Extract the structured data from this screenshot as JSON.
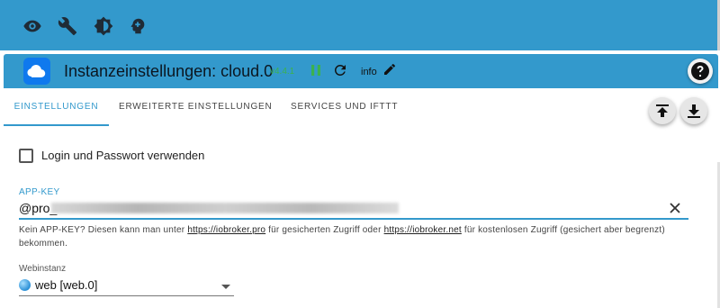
{
  "topbar": {
    "icons": [
      "eye-icon",
      "wrench-icon",
      "brightness-icon",
      "brain-icon"
    ]
  },
  "header": {
    "title": "Instanzeinstellungen: cloud.0",
    "version": "v4.4.1",
    "info_label": "info",
    "icons": [
      "cloud-logo-icon",
      "pause-icon",
      "reload-icon",
      "pencil-icon",
      "help-icon"
    ]
  },
  "tabs": [
    {
      "label": "EINSTELLUNGEN",
      "active": true
    },
    {
      "label": "ERWEITERTE EINSTELLUNGEN",
      "active": false
    },
    {
      "label": "SERVICES UND IFTTT",
      "active": false
    }
  ],
  "actions": {
    "icons": [
      "upload-icon",
      "download-icon"
    ]
  },
  "form": {
    "login_checkbox_label": "Login und Passwort verwenden",
    "login_checked": false,
    "api_key_label": "APP-KEY",
    "api_key_value": "@pro_",
    "api_help_prefix": "Kein APP-KEY? Diesen kann man unter ",
    "api_help_link1": "https://iobroker.pro",
    "api_help_middle": " für gesicherten Zugriff oder ",
    "api_help_link2": "https://iobroker.net",
    "api_help_suffix": " für kostenlosen Zugriff (gesichert aber begrenzt) bekommen.",
    "webinstance_label": "Webinstanz",
    "webinstance_value": "web [web.0]"
  },
  "colors": {
    "accent": "#3399cc",
    "version": "#3bb24e",
    "logo": "#0f79ee"
  }
}
